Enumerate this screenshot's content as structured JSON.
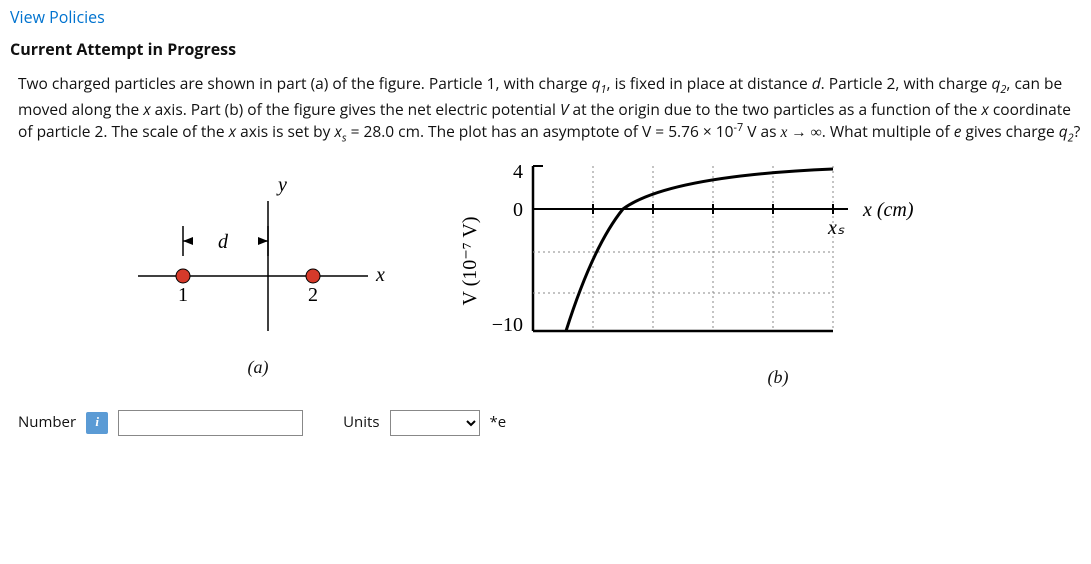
{
  "header": {
    "view_policies": "View Policies",
    "attempt": "Current Attempt in Progress"
  },
  "problem": {
    "line1_a": "Two charged particles are shown in part (a) of the figure. Particle 1, with charge ",
    "q1": "q",
    "q1_sub": "1",
    "line1_b": ", is fixed in place at distance ",
    "d_var": "d",
    "line1_c": ". Particle 2, with charge ",
    "q2": "q",
    "q2_sub": "2",
    "line2_a": ", can be moved along the ",
    "x_var": "x",
    "line2_b": " axis. Part (b) of the figure gives the net electric potential ",
    "V_var": "V",
    "line2_c": " at the origin due to the two particles as a function of the ",
    "line2_d": " coordinate of particle 2. The scale of the ",
    "line2_e": " axis is set by ",
    "xs_eq": "x",
    "xs_sub": "s",
    "xs_val": " = 28.0 cm. The plot has an asymptote of ",
    "Vval": "V = 5.76 × 10",
    "Vexp": "-7",
    "Vunit": " V as ",
    "limit": "x → ∞",
    "line3_a": ". What multiple of ",
    "e_var": "e",
    "line3_b": " gives charge ",
    "q2b": "q",
    "q2b_sub": "2",
    "qmark": "?"
  },
  "figure_a": {
    "y_label": "y",
    "x_label": "x",
    "d_label": "d",
    "p1": "1",
    "p2": "2",
    "caption": "(a)"
  },
  "figure_b": {
    "y_axis_label": "V (10⁻⁷ V)",
    "x_axis_label": "x (cm)",
    "xs_tick": "xₛ",
    "y_top": "4",
    "y_mid": "0",
    "y_bot": "−10",
    "caption": "(b)"
  },
  "chart_data": {
    "type": "line",
    "title": "",
    "xlabel": "x (cm)",
    "ylabel": "V (10^-7 V)",
    "xlim": [
      0,
      28.0
    ],
    "ylim": [
      -10,
      4
    ],
    "asymptote_y": 5.76,
    "xs": 28.0,
    "series": [
      {
        "name": "V(x)",
        "x": [
          3.0,
          4.0,
          5.0,
          6.0,
          7.0,
          8.4,
          10.0,
          12.0,
          14.0,
          16.8,
          19.6,
          22.4,
          25.2,
          28.0
        ],
        "values": [
          -10.0,
          -6.0,
          -3.6,
          -2.0,
          -0.9,
          0.0,
          1.0,
          1.8,
          2.4,
          3.0,
          3.3,
          3.6,
          3.8,
          3.9
        ]
      }
    ]
  },
  "answer": {
    "number_label": "Number",
    "info": "i",
    "number_value": "",
    "units_label": "Units",
    "units_selected": "",
    "units_suffix": "*e"
  }
}
